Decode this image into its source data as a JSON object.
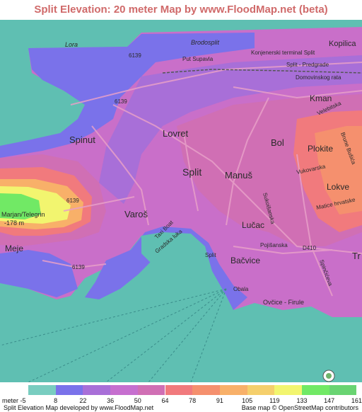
{
  "title": "Split Elevation: 20 meter Map by www.FloodMap.net (beta)",
  "map": {
    "place_labels": [
      "Split",
      "Lora",
      "Brodosplit",
      "Kopilica",
      "Konjenerski terminal Split",
      "Put Supavla",
      "Split - Predgrade",
      "Domovinskog rata",
      "Kman",
      "Velebitska",
      "Lovret",
      "Bol",
      "Plokite",
      "Brune Bušića",
      "Spinut",
      "Manuš",
      "Vukovarska",
      "Lokve",
      "Varoš",
      "Sukoišanska",
      "Matice hrvatske",
      "Lučac",
      "Marjan/Telegrin",
      "-178 m",
      "Meje",
      "Pojišanska",
      "D410",
      "Tr",
      "Bačvice",
      "Gradska luka",
      "Taxi Boat",
      "Spinčićeva",
      "Split",
      "6139",
      "6139",
      "6139",
      "6139",
      "Ovčice - Firule",
      "Obala"
    ],
    "road_label": "6139",
    "osm_badge_text": "OpenStreetMap"
  },
  "legend": {
    "colors": [
      "#79cdc0",
      "#7a72ea",
      "#a86fd8",
      "#c66fcf",
      "#d06fb4",
      "#f17a7d",
      "#f5906e",
      "#f8b069",
      "#f5cf6c",
      "#f2f56f",
      "#71e965",
      "#69d472"
    ],
    "labels": [
      "meter -5",
      "8",
      "22",
      "36",
      "50",
      "64",
      "78",
      "91",
      "105",
      "119",
      "133",
      "147",
      "161"
    ],
    "credit_left": "Split Elevation Map developed by www.FloodMap.net",
    "credit_right": "Base map © OpenStreetMap contributors"
  }
}
